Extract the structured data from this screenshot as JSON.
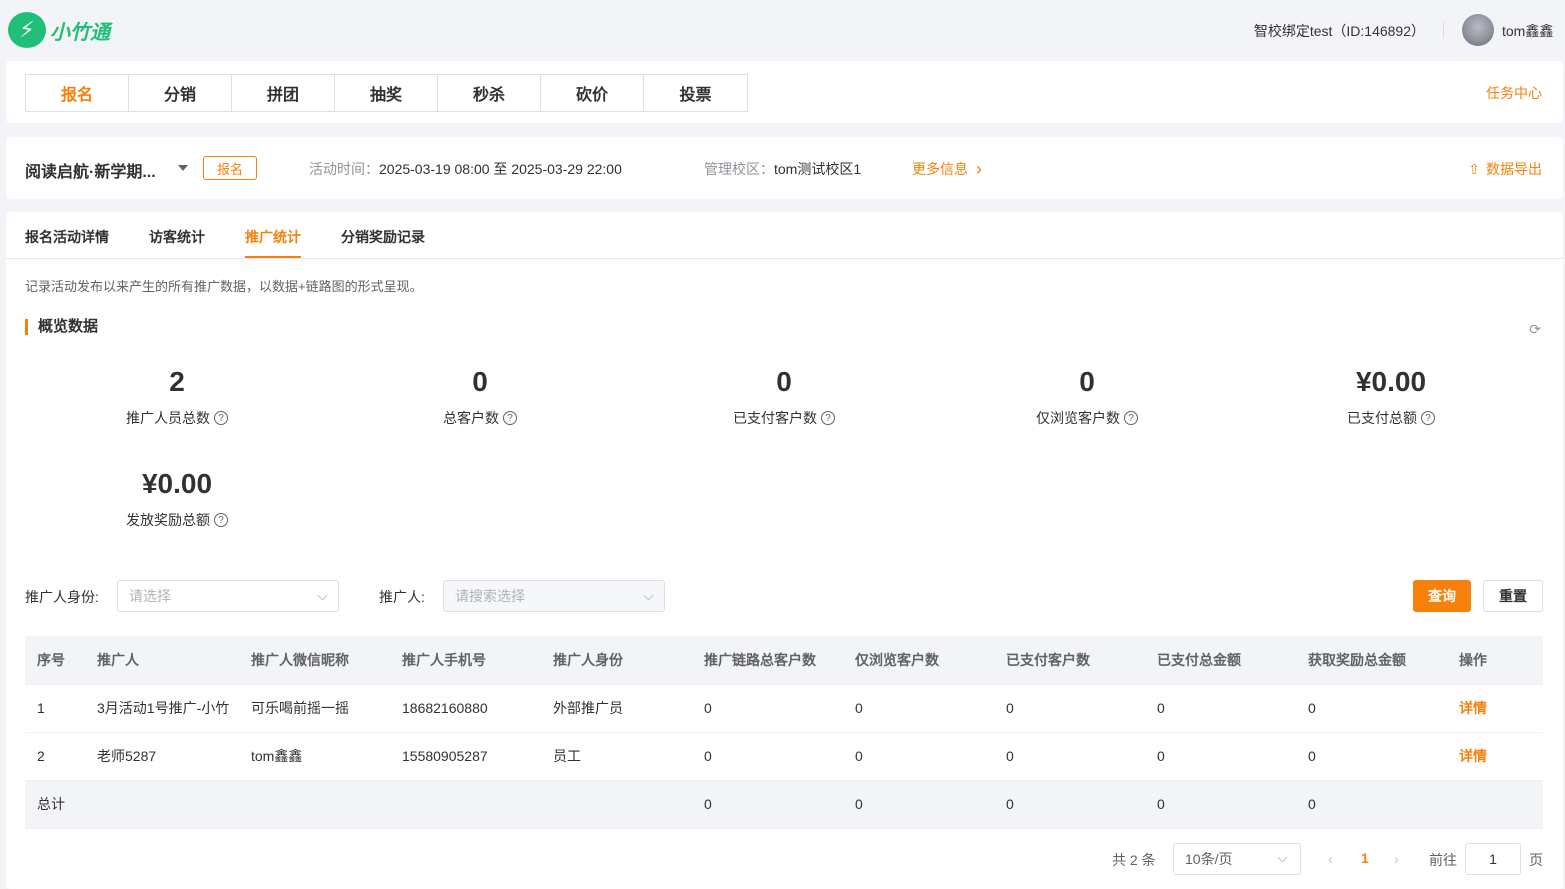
{
  "header": {
    "logo_glyph": "⚡",
    "logo_text": "小竹通",
    "school": "智校绑定test（ID:146892）",
    "username": "tom鑫鑫"
  },
  "module_tabs": [
    {
      "label": "报名",
      "active": true
    },
    {
      "label": "分销",
      "active": false
    },
    {
      "label": "拼团",
      "active": false
    },
    {
      "label": "抽奖",
      "active": false
    },
    {
      "label": "秒杀",
      "active": false
    },
    {
      "label": "砍价",
      "active": false
    },
    {
      "label": "投票",
      "active": false
    }
  ],
  "task_center": "任务中心",
  "activity": {
    "name": "阅读启航·新学期...",
    "tag": "报名",
    "time_label": "活动时间：",
    "time": "2025-03-19 08:00 至 2025-03-29 22:00",
    "campus_label": "管理校区：",
    "campus": "tom测试校区1",
    "more": "更多信息",
    "more_icon": "›",
    "export": "数据导出",
    "export_icon": "⇧"
  },
  "sub_tabs": [
    "报名活动详情",
    "访客统计",
    "推广统计",
    "分销奖励记录"
  ],
  "description": "记录活动发布以来产生的所有推广数据，以数据+链路图的形式呈现。",
  "overview_title": "概览数据",
  "refresh_icon": "⟳",
  "stats": [
    {
      "value": "2",
      "label": "推广人员总数"
    },
    {
      "value": "0",
      "label": "总客户数"
    },
    {
      "value": "0",
      "label": "已支付客户数"
    },
    {
      "value": "0",
      "label": "仅浏览客户数"
    },
    {
      "value": "¥0.00",
      "label": "已支付总额"
    },
    {
      "value": "¥0.00",
      "label": "发放奖励总额"
    }
  ],
  "help_icon": "?",
  "filters": {
    "identity_label": "推广人身份:",
    "identity_placeholder": "请选择",
    "promoter_label": "推广人:",
    "promoter_placeholder": "请搜索选择",
    "query": "查询",
    "reset": "重置"
  },
  "table": {
    "columns": [
      "序号",
      "推广人",
      "推广人微信昵称",
      "推广人手机号",
      "推广人身份",
      "推广链路总客户数",
      "仅浏览客户数",
      "已支付客户数",
      "已支付总金额",
      "获取奖励总金额",
      "操作"
    ],
    "rows": [
      [
        "1",
        "3月活动1号推广-小竹",
        "可乐喝前摇一摇",
        "18682160880",
        "外部推广员",
        "0",
        "0",
        "0",
        "0",
        "0",
        "详情"
      ],
      [
        "2",
        "老师5287",
        "tom鑫鑫",
        "15580905287",
        "员工",
        "0",
        "0",
        "0",
        "0",
        "0",
        "详情"
      ]
    ],
    "total": [
      "总计",
      "",
      "",
      "",
      "",
      "0",
      "0",
      "0",
      "0",
      "0",
      ""
    ]
  },
  "pagination": {
    "total_text": "共 2 条",
    "page_size": "10条/页",
    "prev": "‹",
    "next": "›",
    "current": "1",
    "goto_label": "前往",
    "goto_value": "1",
    "page_suffix": "页"
  },
  "colors": {
    "accent": "#f7800b",
    "brand": "#1fbf7a"
  }
}
